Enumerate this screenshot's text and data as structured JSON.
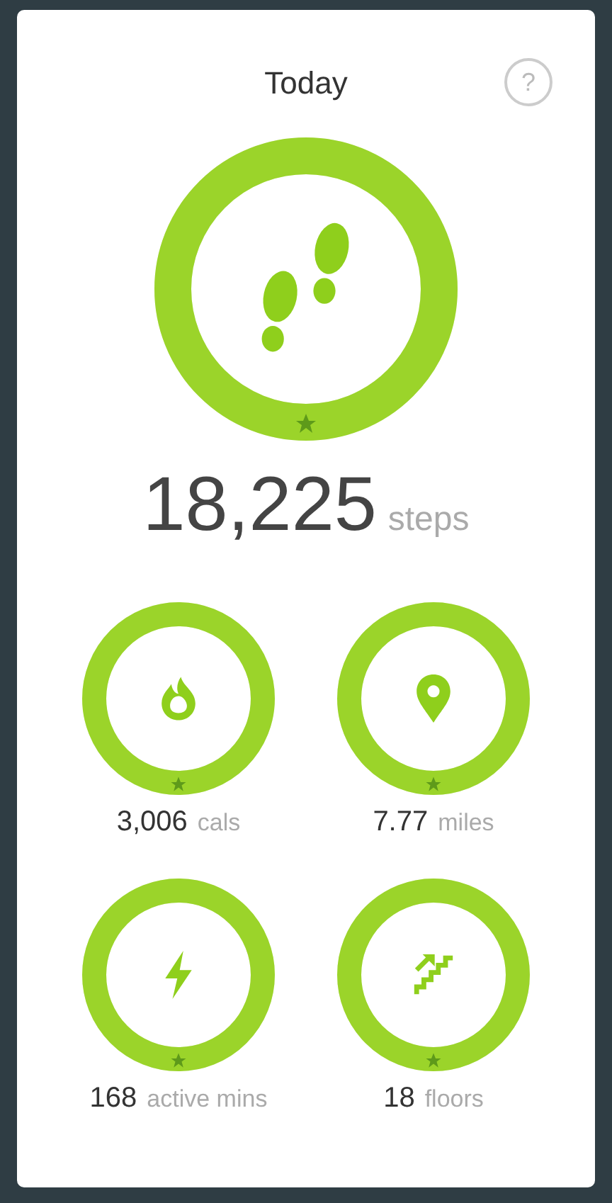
{
  "header": {
    "title": "Today",
    "help": "?"
  },
  "main": {
    "kind": "steps",
    "value": "18,225",
    "unit": "steps",
    "level": 1,
    "goal_met": true
  },
  "stats": [
    {
      "kind": "calories",
      "value": "3,006",
      "unit": "cals",
      "level": 1,
      "goal_met": true
    },
    {
      "kind": "distance",
      "value": "7.77",
      "unit": "miles",
      "level": 1,
      "goal_met": true
    },
    {
      "kind": "active",
      "value": "168",
      "unit": "active mins",
      "level": 1,
      "goal_met": true
    },
    {
      "kind": "floors",
      "value": "18",
      "unit": "floors",
      "level": 1,
      "goal_met": true
    }
  ]
}
